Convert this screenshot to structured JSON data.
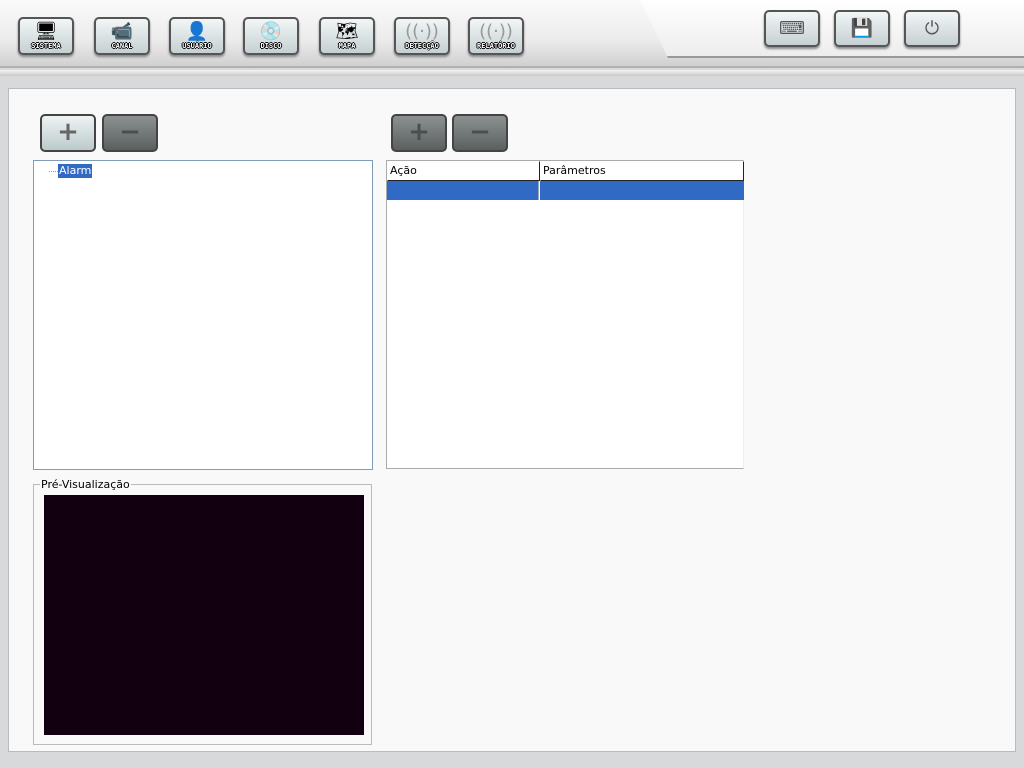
{
  "toolbar": {
    "items": [
      {
        "label": "SISTEMA",
        "icon": "computer-icon"
      },
      {
        "label": "CANAL",
        "icon": "camera-icon"
      },
      {
        "label": "USUÁRIO",
        "icon": "user-icon"
      },
      {
        "label": "DISCO",
        "icon": "disc-icon"
      },
      {
        "label": "MAPA",
        "icon": "map-icon"
      },
      {
        "label": "DETECÇÃO",
        "icon": "antenna-icon"
      },
      {
        "label": "RELATÓRIO",
        "icon": "antenna-icon"
      }
    ],
    "right": [
      {
        "icon": "keyboard-icon"
      },
      {
        "icon": "save-icon"
      },
      {
        "icon": "power-icon"
      }
    ]
  },
  "tree": {
    "items": [
      "Alarm"
    ],
    "selected": "Alarm"
  },
  "table": {
    "columns": [
      "Ação",
      "Parâmetros"
    ],
    "rows": [
      [
        "",
        ""
      ]
    ]
  },
  "preview": {
    "label": "Pré-Visualização"
  },
  "colors": {
    "selection": "#316ac5",
    "video_bg": "#120010"
  }
}
